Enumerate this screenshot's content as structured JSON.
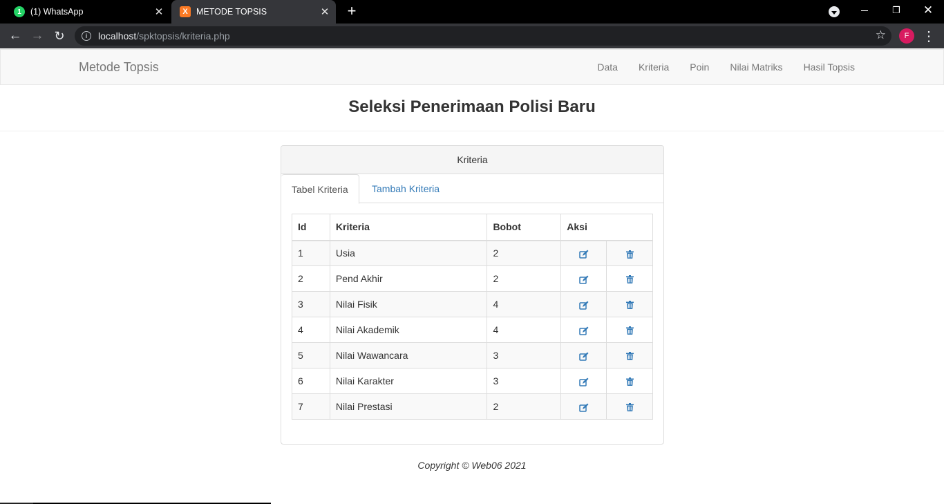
{
  "browser": {
    "tabs": [
      {
        "label": "(1) WhatsApp",
        "favicon": "whatsapp-icon",
        "favicon_text": "1"
      },
      {
        "label": "METODE TOPSIS",
        "favicon": "xampp-icon",
        "favicon_text": "X",
        "active": true
      }
    ],
    "url_host": "localhost",
    "url_path": "/spktopsis/kriteria.php",
    "profile_initial": "F",
    "colors": {
      "tabstrip": "#000000",
      "toolbar": "#35363a",
      "omnibox": "#202124",
      "profile": "#d81b60"
    }
  },
  "navbar": {
    "brand": "Metode Topsis",
    "links": [
      "Data",
      "Kriteria",
      "Poin",
      "Nilai Matriks",
      "Hasil Topsis"
    ]
  },
  "page": {
    "title": "Seleksi Penerimaan Polisi Baru"
  },
  "panel": {
    "heading": "Kriteria",
    "tabs": [
      "Tabel Kriteria",
      "Tambah Kriteria"
    ],
    "active_tab": "Tabel Kriteria"
  },
  "table": {
    "headers": [
      "Id",
      "Kriteria",
      "Bobot",
      "Aksi"
    ],
    "rows": [
      {
        "id": "1",
        "kriteria": "Usia",
        "bobot": "2"
      },
      {
        "id": "2",
        "kriteria": "Pend Akhir",
        "bobot": "2"
      },
      {
        "id": "3",
        "kriteria": "Nilai Fisik",
        "bobot": "4"
      },
      {
        "id": "4",
        "kriteria": "Nilai Akademik",
        "bobot": "4"
      },
      {
        "id": "5",
        "kriteria": "Nilai Wawancara",
        "bobot": "3"
      },
      {
        "id": "6",
        "kriteria": "Nilai Karakter",
        "bobot": "3"
      },
      {
        "id": "7",
        "kriteria": "Nilai Prestasi",
        "bobot": "2"
      }
    ],
    "action_icons": [
      "edit-icon",
      "trash-icon"
    ],
    "action_color": "#337ab7"
  },
  "footer": {
    "text": "Copyright © Web06 2021"
  }
}
